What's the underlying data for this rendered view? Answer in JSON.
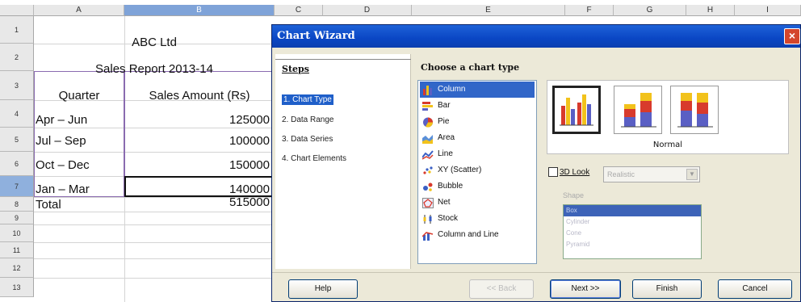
{
  "sheet": {
    "columns": [
      "A",
      "B",
      "C",
      "D",
      "E",
      "F",
      "G",
      "H",
      "I"
    ],
    "rows": [
      "1",
      "2",
      "3",
      "4",
      "5",
      "6",
      "7",
      "8",
      "9",
      "10",
      "11",
      "12",
      "13"
    ],
    "title": "ABC Ltd",
    "subtitle": "Sales Report 2013-14",
    "header_quarter": "Quarter",
    "header_amount": "Sales Amount (Rs)",
    "data": [
      {
        "quarter": "Apr – Jun",
        "amount": "125000"
      },
      {
        "quarter": "Jul – Sep",
        "amount": "100000"
      },
      {
        "quarter": "Oct – Dec",
        "amount": "150000"
      },
      {
        "quarter": "Jan – Mar",
        "amount": "140000"
      }
    ],
    "total_label": "Total",
    "total_value": "515000"
  },
  "dialog": {
    "title": "Chart Wizard",
    "close_glyph": "×",
    "steps_heading": "Steps",
    "steps": [
      "1. Chart Type",
      "2. Data Range",
      "3. Data Series",
      "4. Chart Elements"
    ],
    "choose_label": "Choose a chart type",
    "chart_types": [
      "Column",
      "Bar",
      "Pie",
      "Area",
      "Line",
      "XY (Scatter)",
      "Bubble",
      "Net",
      "Stock",
      "Column and Line"
    ],
    "selected_type": "Column",
    "variant_label": "Normal",
    "look3d_label": "3D Look",
    "look3d_value": "Realistic",
    "shape_label": "Shape",
    "shapes": [
      "Box",
      "Cylinder",
      "Cone",
      "Pyramid"
    ],
    "buttons": {
      "help": "Help",
      "back": "<< Back",
      "next": "Next >>",
      "finish": "Finish",
      "cancel": "Cancel"
    }
  },
  "colors": {
    "title_bar": "#0a46c4",
    "selection": "#3166c8",
    "dialog_bg": "#ece9d8",
    "bar_red": "#d83a2c",
    "bar_yellow": "#f2c21b",
    "bar_blue": "#5a5fc4"
  }
}
